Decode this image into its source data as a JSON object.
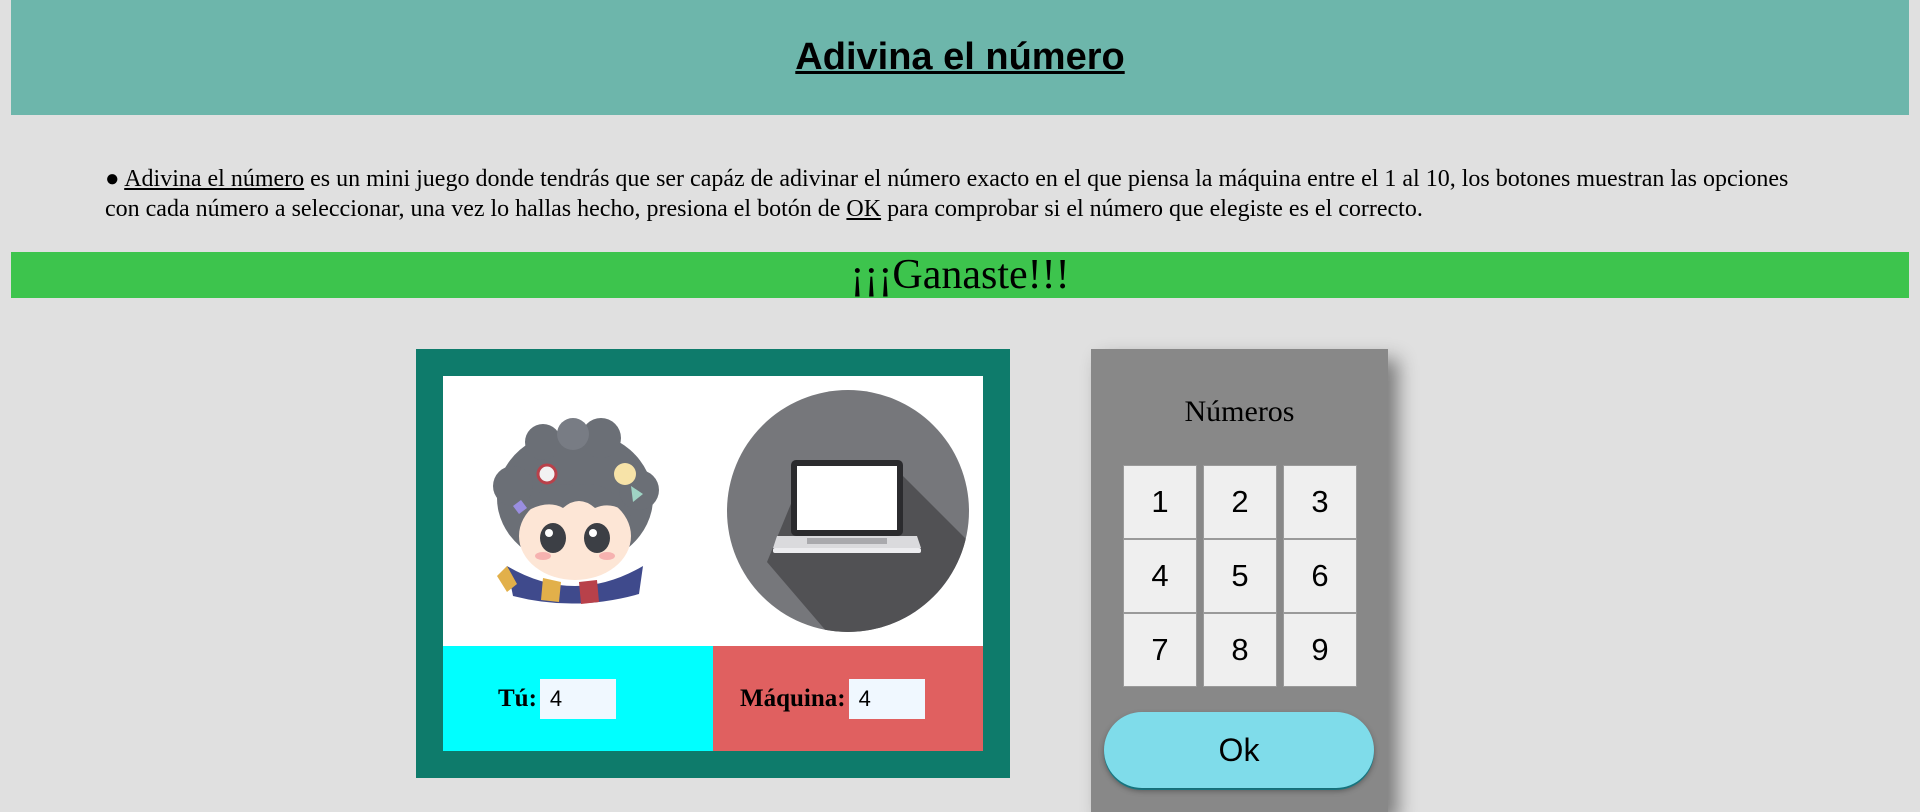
{
  "header": {
    "title": "Adivina el número"
  },
  "intro": {
    "bullet": "●",
    "link": "Adivina el número",
    "text1": " es un mini juego donde tendrás que ser capáz de adivinar el número exacto en el que piensa la máquina entre el 1 al 10, los botones muestran las opciones con cada número a seleccionar, una vez lo hallas hecho, presiona el botón de ",
    "ok_link": "OK",
    "text2": " para comprobar si el número que elegiste es el correcto."
  },
  "status": {
    "message": "¡¡¡Ganaste!!!",
    "color": "#3dc44d"
  },
  "game": {
    "player_icon": "chibi-avatar-icon",
    "machine_icon": "laptop-icon",
    "you_label": "Tú:",
    "you_value": "4",
    "machine_label": "Máquina:",
    "machine_value": "4",
    "colors": {
      "frame": "#0e7b6b",
      "you_bg": "#00ffff",
      "machine_bg": "#e06060"
    }
  },
  "keypad": {
    "title": "Números",
    "keys": [
      "1",
      "2",
      "3",
      "4",
      "5",
      "6",
      "7",
      "8",
      "9"
    ],
    "ok_label": "Ok",
    "ok_color": "#7fdcea"
  }
}
